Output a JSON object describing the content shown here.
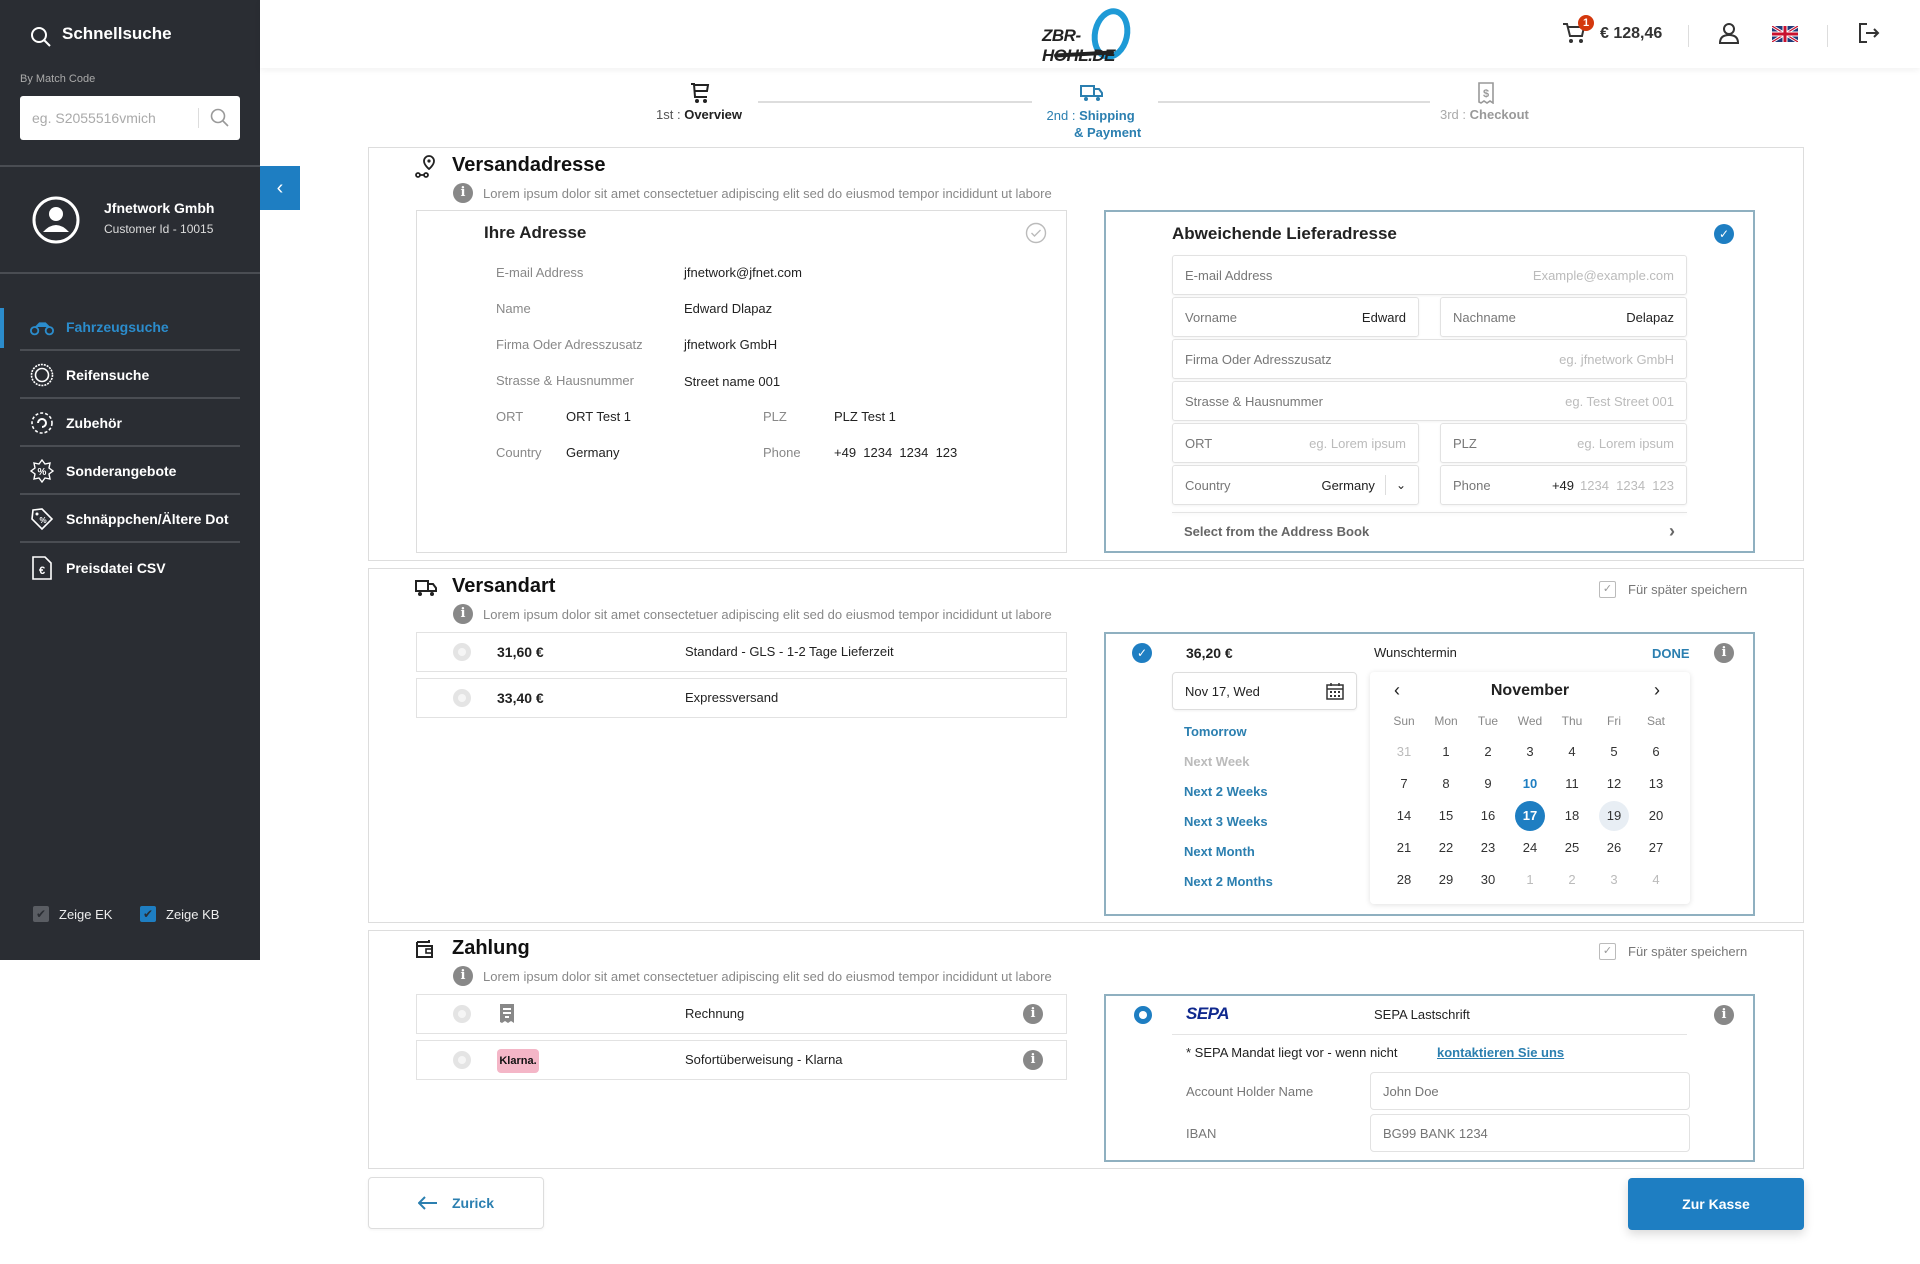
{
  "sidebar": {
    "quick_search_title": "Schnellsuche",
    "match_code_label": "By Match Code",
    "match_code_placeholder": "eg. S2055516vmich",
    "user": {
      "name": "Jfnetwork Gmbh",
      "customer_id": "Customer Id - 10015"
    },
    "nav": [
      {
        "label": "Fahrzeugsuche",
        "icon": "motorcycle-icon",
        "active": true
      },
      {
        "label": "Reifensuche",
        "icon": "tire-icon",
        "active": false
      },
      {
        "label": "Zubehör",
        "icon": "accessories-gear-icon",
        "active": false
      },
      {
        "label": "Sonderangebote",
        "icon": "discount-badge-icon",
        "active": false
      },
      {
        "label": "Schnäppchen/Ältere Dot",
        "icon": "price-tag-icon",
        "active": false
      },
      {
        "label": "Preisdatei CSV",
        "icon": "euro-file-icon",
        "active": false
      }
    ],
    "checkboxes": [
      {
        "label": "Zeige EK",
        "checked": true
      },
      {
        "label": "Zeige KB",
        "checked": true
      }
    ]
  },
  "header": {
    "logo_text": "ZBR-HOHL.DE",
    "cart_count": "1",
    "cart_total": "€ 128,46"
  },
  "stepper": {
    "steps": [
      {
        "num": "1st :",
        "label": "Overview",
        "state": "done"
      },
      {
        "num": "2nd :",
        "label": "Shipping",
        "label2": "& Payment",
        "state": "active"
      },
      {
        "num": "3rd :",
        "label": "Checkout",
        "state": "pending"
      }
    ]
  },
  "shipping_address": {
    "title": "Versandadresse",
    "info": "Lorem ipsum dolor sit amet consectetuer adipiscing elit sed do eiusmod tempor incididunt ut labore",
    "own": {
      "title": "Ihre Adresse",
      "email_label": "E-mail Address",
      "email": "jfnetwork@jfnet.com",
      "name_label": "Name",
      "name": "Edward Dlapaz",
      "company_label": "Firma Oder Adresszusatz",
      "company": "jfnetwork GmbH",
      "street_label": "Strasse & Hausnummer",
      "street": "Street name 001",
      "ort_label": "ORT",
      "ort": "ORT Test 1",
      "plz_label": "PLZ",
      "plz": "PLZ Test 1",
      "country_label": "Country",
      "country": "Germany",
      "phone_label": "Phone",
      "phone": "+49  1234  1234  123"
    },
    "alt": {
      "title": "Abweichende Lieferadresse",
      "email_label": "E-mail Address",
      "email_placeholder": "Example@example.com",
      "vorname_label": "Vorname",
      "vorname": "Edward",
      "nachname_label": "Nachname",
      "nachname": "Delapaz",
      "company_label": "Firma Oder Adresszusatz",
      "company_placeholder": "eg. jfnetwork GmbH",
      "street_label": "Strasse & Hausnummer",
      "street_placeholder": "eg. Test Street 001",
      "ort_label": "ORT",
      "ort_placeholder": "eg. Lorem ipsum",
      "plz_label": "PLZ",
      "plz_placeholder": "eg. Lorem ipsum",
      "country_label": "Country",
      "country": "Germany",
      "phone_label": "Phone",
      "phone_prefix": "+49",
      "phone_placeholder": "1234  1234  123",
      "address_book": "Select from the Address Book"
    }
  },
  "shipping_method": {
    "title": "Versandart",
    "info": "Lorem ipsum dolor sit amet consectetuer adipiscing elit sed do eiusmod tempor incididunt ut labore",
    "save_later": "Für später speichern",
    "options": [
      {
        "price": "31,60 €",
        "desc": "Standard - GLS - 1-2 Tage Lieferzeit"
      },
      {
        "price": "33,40 €",
        "desc": "Expressversand"
      }
    ],
    "selected": {
      "price": "36,20 €",
      "label": "Wunschtermin",
      "done": "DONE",
      "date_value": "Nov 17, Wed",
      "quick_picks": [
        {
          "label": "Tomorrow",
          "enabled": true
        },
        {
          "label": "Next Week",
          "enabled": false
        },
        {
          "label": "Next 2 Weeks",
          "enabled": true
        },
        {
          "label": "Next 3 Weeks",
          "enabled": true
        },
        {
          "label": "Next Month",
          "enabled": true
        },
        {
          "label": "Next 2 Months",
          "enabled": true
        }
      ],
      "calendar": {
        "month": "November",
        "weekdays": [
          "Sun",
          "Mon",
          "Tue",
          "Wed",
          "Thu",
          "Fri",
          "Sat"
        ],
        "weeks": [
          [
            "31",
            "1",
            "2",
            "3",
            "4",
            "5",
            "6"
          ],
          [
            "7",
            "8",
            "9",
            "10",
            "11",
            "12",
            "13"
          ],
          [
            "14",
            "15",
            "16",
            "17",
            "18",
            "19",
            "20"
          ],
          [
            "21",
            "22",
            "23",
            "24",
            "25",
            "26",
            "27"
          ],
          [
            "28",
            "29",
            "30",
            "1",
            "2",
            "3",
            "4"
          ]
        ],
        "muted": [
          [
            0,
            0
          ],
          [
            4,
            3
          ],
          [
            4,
            4
          ],
          [
            4,
            5
          ],
          [
            4,
            6
          ]
        ],
        "today": [
          1,
          3
        ],
        "selected": [
          2,
          3
        ],
        "hover": [
          2,
          5
        ]
      }
    }
  },
  "payment": {
    "title": "Zahlung",
    "info": "Lorem ipsum dolor sit amet consectetuer adipiscing elit sed do eiusmod tempor incididunt ut labore",
    "save_later": "Für später speichern",
    "options": [
      {
        "label": "Rechnung",
        "icon": "receipt-icon"
      },
      {
        "label": "Sofortüberweisung - Klarna",
        "icon": "klarna-logo",
        "logo_text": "Klarna."
      }
    ],
    "selected": {
      "logo_text": "SEPA",
      "label": "SEPA Lastschrift",
      "mandate_note": "* SEPA Mandat liegt vor - wenn nicht",
      "contact_link": "kontaktieren Sie uns",
      "holder_label": "Account Holder Name",
      "holder_placeholder": "John Doe",
      "iban_label": "IBAN",
      "iban_placeholder": "BG99 BANK 1234"
    }
  },
  "actions": {
    "back": "Zurick",
    "checkout": "Zur Kasse"
  },
  "colors": {
    "accent": "#1e7ec2",
    "sidebar_bg": "#2a2d33",
    "badge": "#d4380d",
    "klarna": "#f4b6c7"
  }
}
